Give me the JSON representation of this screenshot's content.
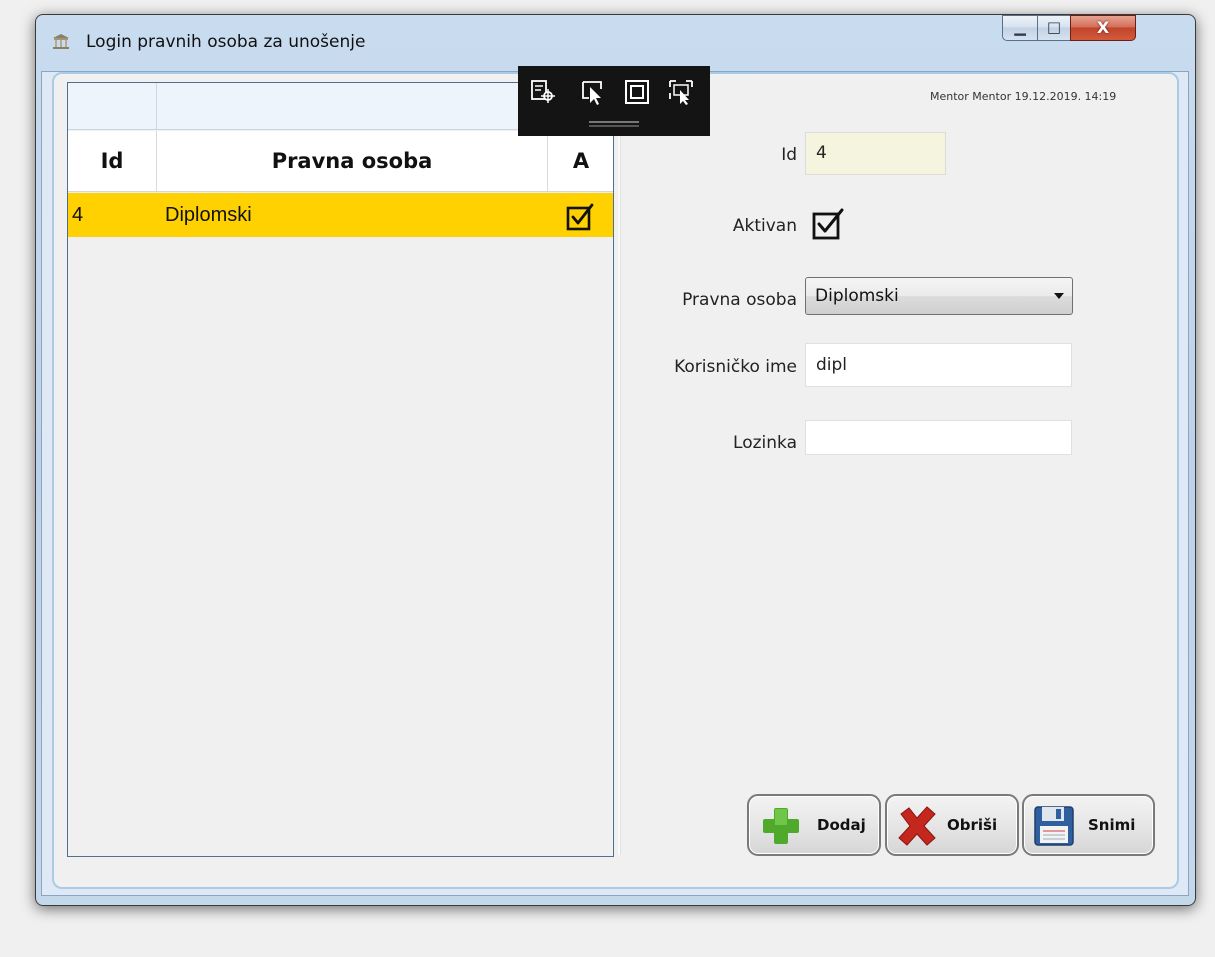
{
  "window": {
    "title": "Login pravnih osoba za unošenje",
    "controls": {
      "minimize": "▁",
      "maximize": "□",
      "close": "X"
    }
  },
  "meta": {
    "timestamp": "Mentor Mentor 19.12.2019. 14:19"
  },
  "grid": {
    "columns": [
      "Id",
      "Pravna osoba",
      "A"
    ],
    "rows": [
      {
        "id": "4",
        "name": "Diplomski",
        "active": true
      }
    ],
    "selected_row_color": "#ffd100"
  },
  "overlay_toolbar": {
    "icons": [
      "inspect-element-icon",
      "select-element-icon",
      "layout-adorner-icon",
      "track-focus-icon"
    ]
  },
  "form": {
    "id": {
      "label": "Id",
      "value": "4"
    },
    "aktivan": {
      "label": "Aktivan",
      "checked": true
    },
    "pravna_osoba": {
      "label": "Pravna osoba",
      "value": "Diplomski"
    },
    "korisnicko_ime": {
      "label": "Korisničko ime",
      "value": "dipl"
    },
    "lozinka": {
      "label": "Lozinka",
      "value": ""
    }
  },
  "buttons": {
    "dodaj": "Dodaj",
    "obrisi": "Obriši",
    "snimi": "Snimi"
  }
}
